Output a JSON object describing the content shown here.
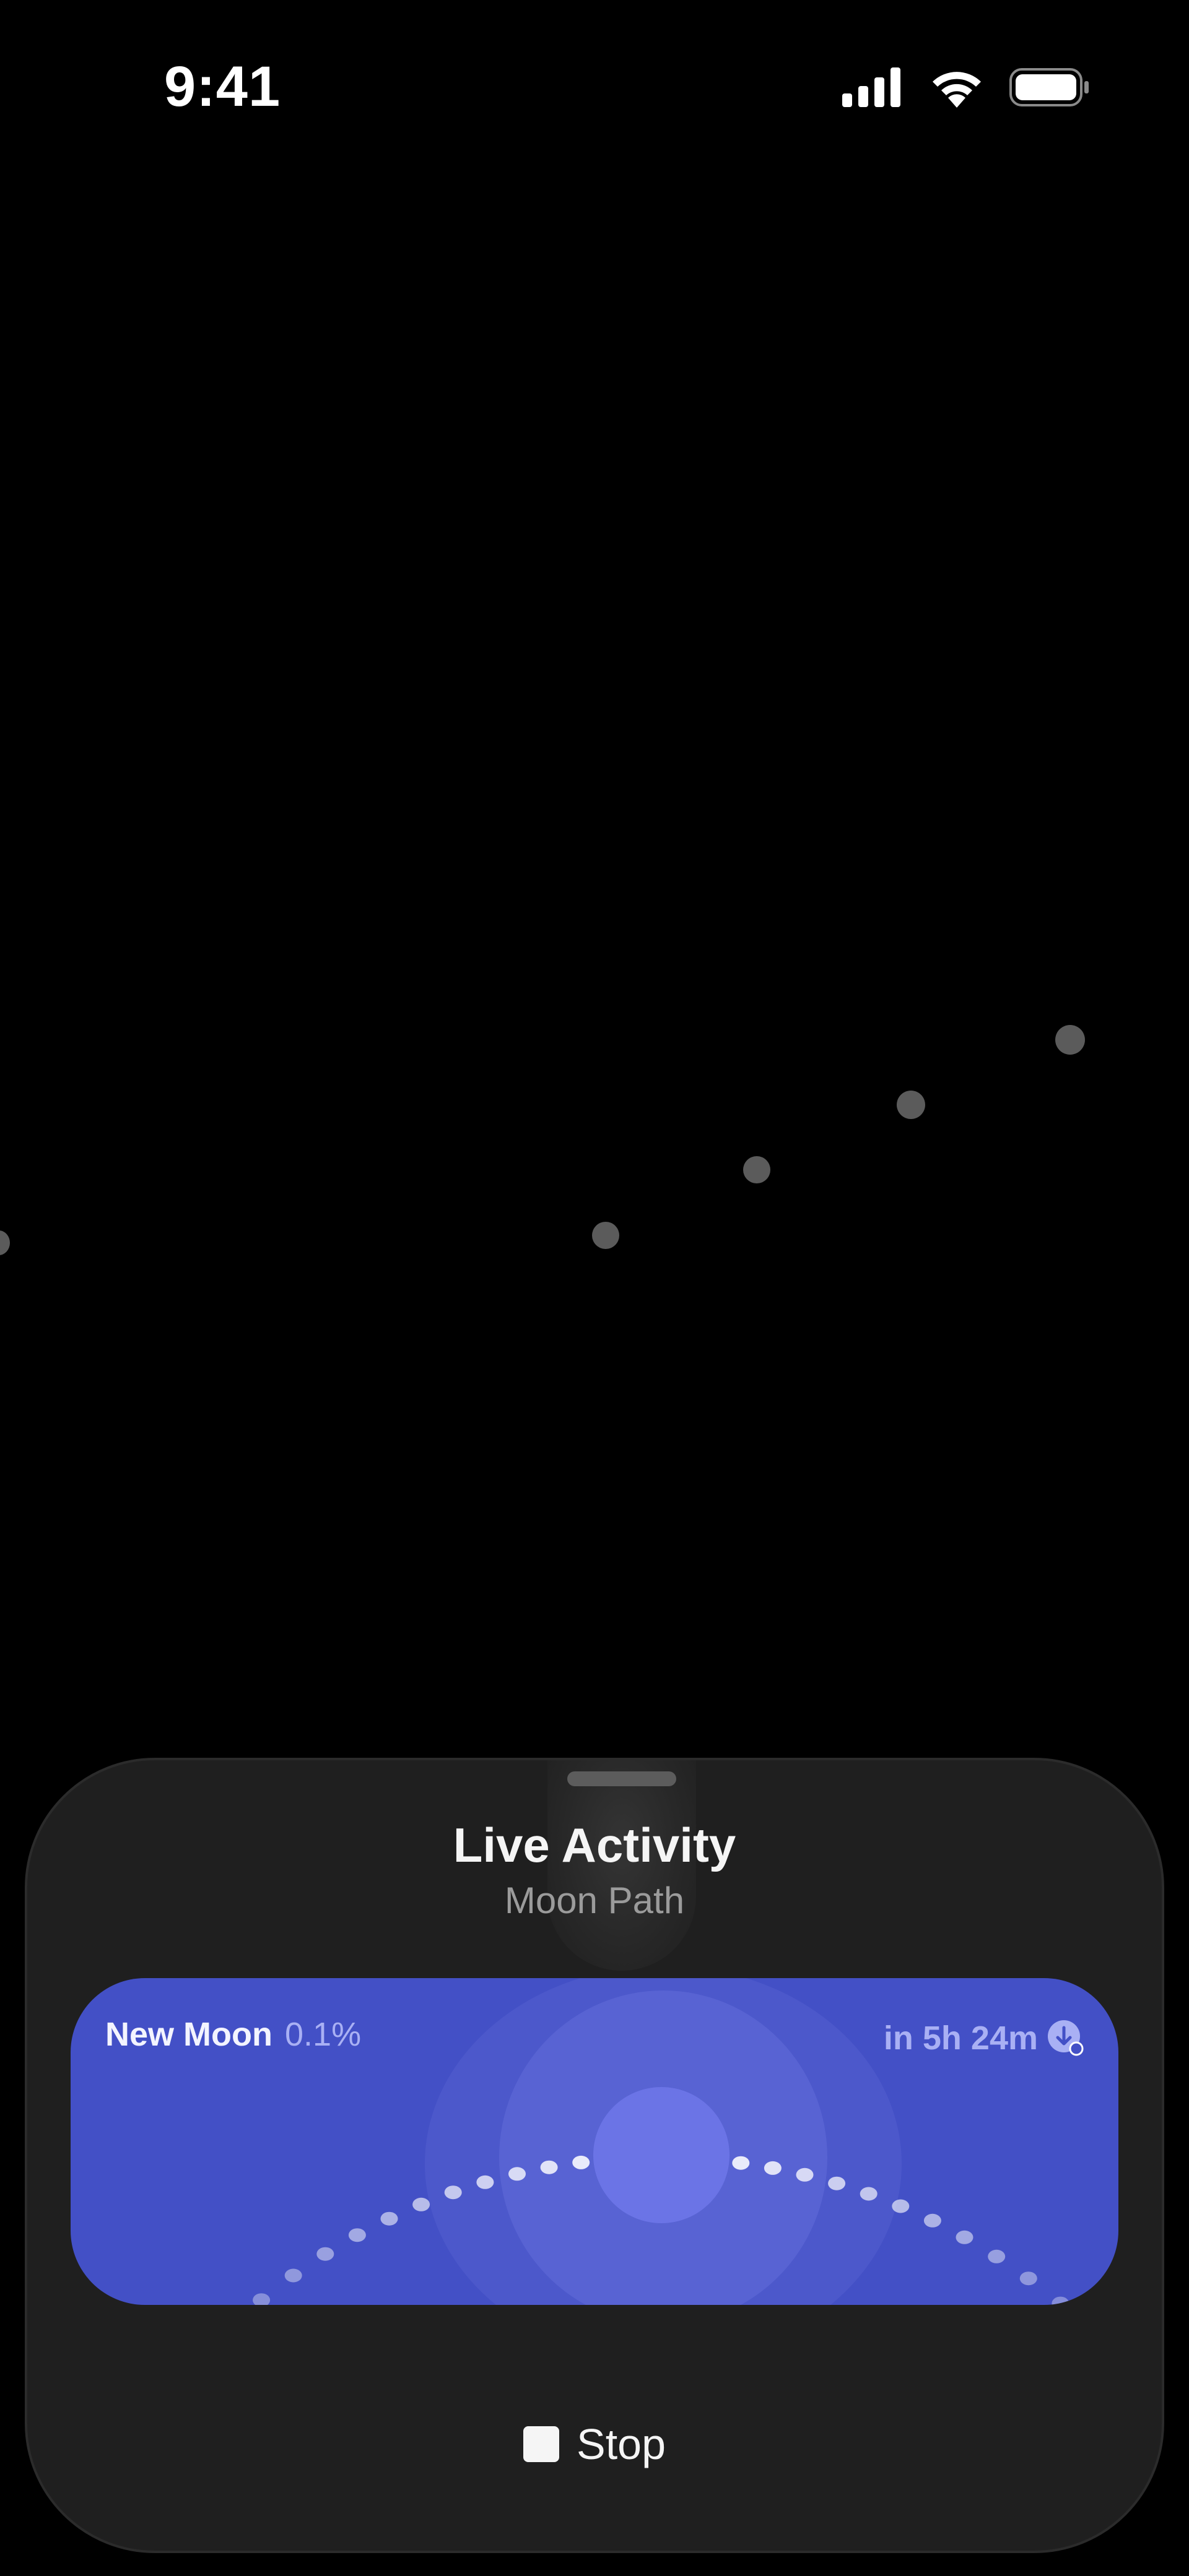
{
  "status_bar": {
    "time": "9:41",
    "signal_icon": "cellular-signal-icon",
    "wifi_icon": "wifi-icon",
    "battery_icon": "battery-icon"
  },
  "sheet": {
    "title": "Live Activity",
    "subtitle": "Moon Path",
    "activity": {
      "phase_name": "New Moon",
      "illumination": "0.1%",
      "countdown": "in 5h 24m",
      "moonset_icon": "moonset-arrow-icon",
      "accent_color": "#4350c6",
      "moon_color": "#6b74e6"
    },
    "stop_label": "Stop",
    "stop_icon": "stop-square-icon"
  },
  "background_icons": "star-dot-icon"
}
